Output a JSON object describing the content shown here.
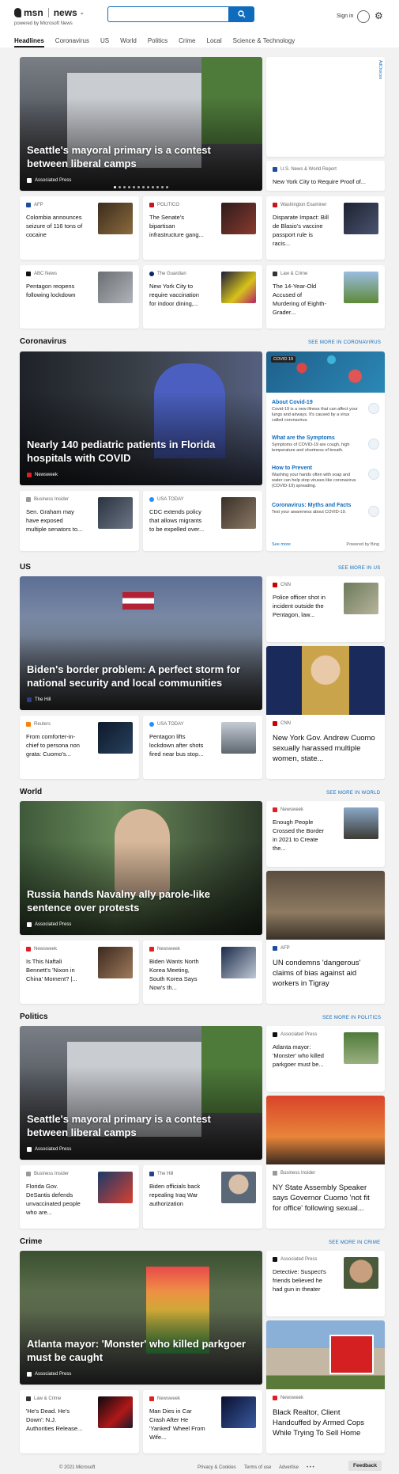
{
  "header": {
    "brand": "msn",
    "product": "news",
    "powered_by": "powered by Microsoft News",
    "search_placeholder": "",
    "signin_label": "Sign in"
  },
  "nav": [
    "Headlines",
    "Coronavirus",
    "US",
    "World",
    "Politics",
    "Crime",
    "Local",
    "Science & Technology"
  ],
  "top": {
    "hero": {
      "title": "Seattle's mayoral primary is a contest between liberal camps",
      "source": "Associated Press"
    },
    "ad": {
      "label": "AdChoices"
    },
    "usnews": {
      "source": "U.S. News & World Report",
      "title": "New York City to Require Proof of..."
    },
    "cards": [
      {
        "source": "AFP",
        "title": "Colombia announces seizure of 116 tons of cocaine"
      },
      {
        "source": "POLITICO",
        "title": "The Senate's bipartisan infrastructure gang..."
      },
      {
        "source": "Washington Examiner",
        "title": "Disparate Impact: Bill de Blasio's vaccine passport rule is racis..."
      },
      {
        "source": "ABC News",
        "title": "Pentagon reopens following lockdown"
      },
      {
        "source": "The Guardian",
        "title": "New York City to require vaccination for indoor dining,..."
      },
      {
        "source": "Law & Crime",
        "title": "The 14-Year-Old Accused of Murdering of Eighth-Grader..."
      }
    ]
  },
  "coronavirus": {
    "heading": "Coronavirus",
    "see_more": "SEE MORE IN CORONAVIRUS",
    "hero": {
      "title": "Nearly 140 pediatric patients in Florida hospitals with COVID",
      "source": "Newsweek"
    },
    "panel": {
      "tag": "COVID 19",
      "items": [
        {
          "title": "About Covid-19",
          "desc": "Covid-19 is a new illness that can affect your lungs and airways. It's caused by a virus called coronavirus."
        },
        {
          "title": "What are the Symptoms",
          "desc": "Symptoms of COVID-19 are cough, high temperature and shortness of breath."
        },
        {
          "title": "How to Prevent",
          "desc": "Washing your hands often with soap and water can help stop viruses like coronavirus (COVID-19) spreading."
        },
        {
          "title": "Coronavirus: Myths and Facts",
          "desc": "Test your awareness about COVID-19."
        }
      ],
      "see_more": "See more",
      "powered": "Powered by Bing"
    },
    "cards": [
      {
        "source": "Business Insider",
        "title": "Sen. Graham may have exposed multiple senators to..."
      },
      {
        "source": "USA TODAY",
        "title": "CDC extends policy that allows migrants to be expelled over..."
      }
    ]
  },
  "us": {
    "heading": "US",
    "see_more": "SEE MORE IN US",
    "hero": {
      "title": "Biden's border problem: A perfect storm for national security and local communities",
      "source": "The Hill"
    },
    "side1": {
      "source": "CNN",
      "title": "Police officer shot in incident outside the Pentagon, law..."
    },
    "tall": {
      "source": "CNN",
      "title": "New York Gov. Andrew Cuomo sexually harassed multiple women, state..."
    },
    "cards": [
      {
        "source": "Reuters",
        "title": "From comforter-in-chief to persona non grata: Cuomo's..."
      },
      {
        "source": "USA TODAY",
        "title": "Pentagon lifts lockdown after shots fired near bus stop..."
      }
    ]
  },
  "world": {
    "heading": "World",
    "see_more": "SEE MORE IN WORLD",
    "hero": {
      "title": "Russia hands Navalny ally parole-like sentence over protests",
      "source": "Associated Press"
    },
    "side1": {
      "source": "Newsweek",
      "title": "Enough People Crossed the Border in 2021 to Create the..."
    },
    "tall": {
      "source": "AFP",
      "title": "UN condemns 'dangerous' claims of bias against aid workers in Tigray"
    },
    "cards": [
      {
        "source": "Newsweek",
        "title": "Is This Naftali Bennett's 'Nixon in China' Moment? |..."
      },
      {
        "source": "Newsweek",
        "title": "Biden Wants North Korea Meeting, South Korea Says Now's th..."
      }
    ]
  },
  "politics": {
    "heading": "Politics",
    "see_more": "SEE MORE IN POLITICS",
    "hero": {
      "title": "Seattle's mayoral primary is a contest between liberal camps",
      "source": "Associated Press"
    },
    "side1": {
      "source": "Associated Press",
      "title": "Atlanta mayor: 'Monster' who killed parkgoer must be..."
    },
    "tall": {
      "source": "Business Insider",
      "title": "NY State Assembly Speaker says Governor Cuomo 'not fit for office' following sexual..."
    },
    "cards": [
      {
        "source": "Business Insider",
        "title": "Florida Gov. DeSantis defends unvaccinated people who are..."
      },
      {
        "source": "The Hill",
        "title": "Biden officials back repealing Iraq War authorization"
      }
    ]
  },
  "crime": {
    "heading": "Crime",
    "see_more": "SEE MORE IN CRIME",
    "hero": {
      "title": "Atlanta mayor: 'Monster' who killed parkgoer must be caught",
      "source": "Associated Press"
    },
    "side1": {
      "source": "Associated Press",
      "title": "Detective: Suspect's friends believed he had gun in theater"
    },
    "tall": {
      "source": "Newsweek",
      "title": "Black Realtor, Client Handcuffed by Armed Cops While Trying To Sell Home"
    },
    "cards": [
      {
        "source": "Law & Crime",
        "title": "'He's Dead. He's Down': N.J. Authorities Release..."
      },
      {
        "source": "Newsweek",
        "title": "Man Dies in Car Crash After He 'Yanked' Wheel From Wife..."
      }
    ]
  },
  "footer": {
    "copyright": "© 2021 Microsoft",
    "privacy": "Privacy & Cookies",
    "terms": "Terms of use",
    "advertise": "Advertise",
    "more": "• • •",
    "feedback": "Feedback"
  }
}
